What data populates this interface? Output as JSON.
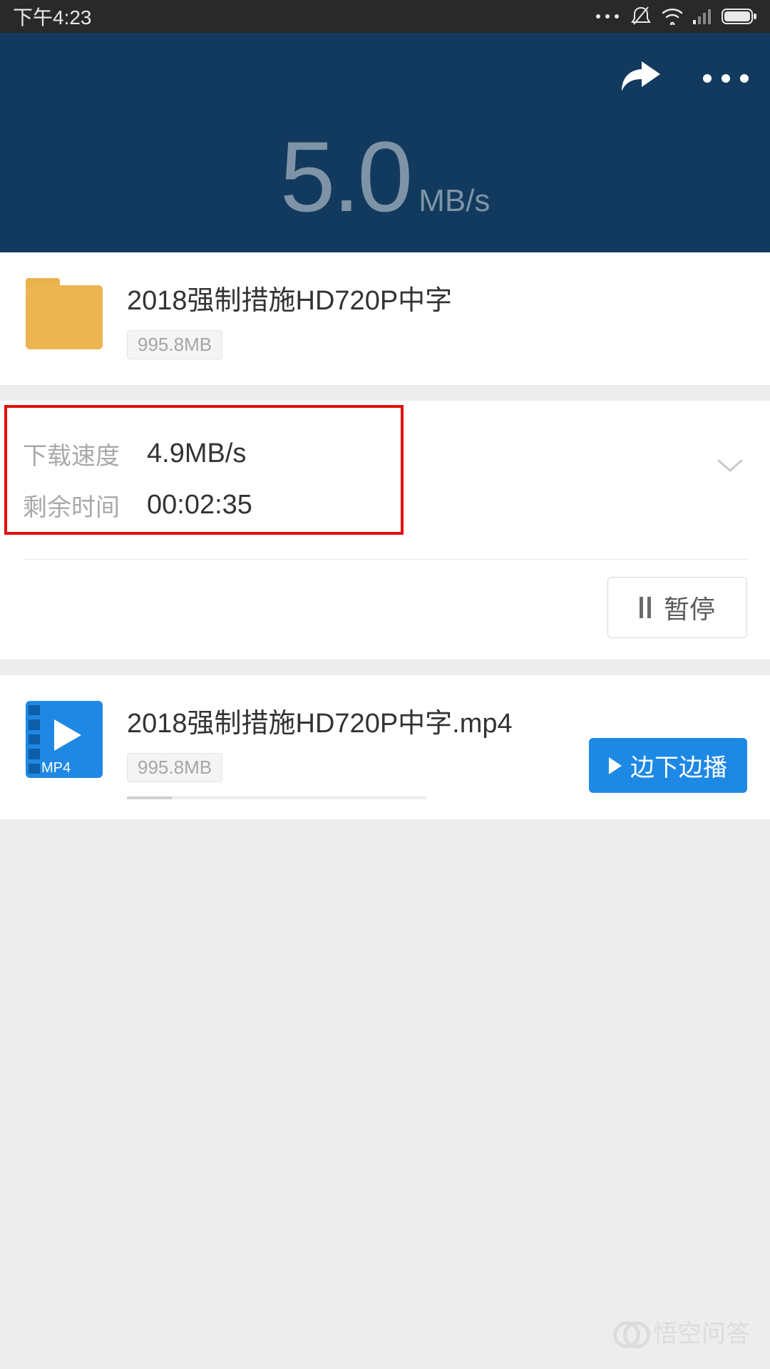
{
  "status_bar": {
    "time": "下午4:23"
  },
  "header": {
    "speed_value": "5.0",
    "speed_unit": "MB/s"
  },
  "folder": {
    "title": "2018强制措施HD720P中字",
    "size": "995.8MB"
  },
  "details": {
    "speed_label": "下载速度",
    "speed_value": "4.9MB/s",
    "remaining_label": "剩余时间",
    "remaining_value": "00:02:35",
    "pause_label": "暂停"
  },
  "file": {
    "title": "2018强制措施HD720P中字.mp4",
    "size": "995.8MB",
    "format_label": "MP4",
    "play_label": "边下边播"
  },
  "watermark": {
    "text": "悟空问答"
  }
}
